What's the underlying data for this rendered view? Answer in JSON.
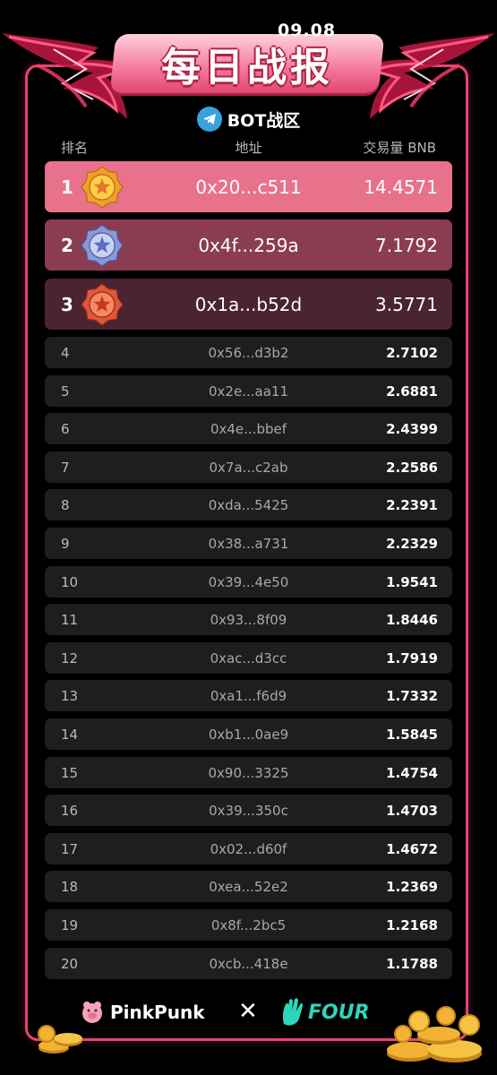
{
  "header": {
    "date": "09.08",
    "title": "每日战报",
    "zone_label": "BOT战区"
  },
  "columns": {
    "rank": "排名",
    "address": "地址",
    "volume": "交易量 BNB"
  },
  "top3": [
    {
      "rank": "1",
      "address": "0x20...c511",
      "volume": "14.4571",
      "medal": "gold-medal-icon",
      "bg": "#e8728c"
    },
    {
      "rank": "2",
      "address": "0x4f...259a",
      "volume": "7.1792",
      "medal": "silver-medal-icon",
      "bg": "#8a3d52"
    },
    {
      "rank": "3",
      "address": "0x1a...b52d",
      "volume": "3.5771",
      "medal": "bronze-medal-icon",
      "bg": "#4a2430"
    }
  ],
  "rows": [
    {
      "rank": "4",
      "address": "0x56...d3b2",
      "volume": "2.7102"
    },
    {
      "rank": "5",
      "address": "0x2e...aa11",
      "volume": "2.6881"
    },
    {
      "rank": "6",
      "address": "0x4e...bbef",
      "volume": "2.4399"
    },
    {
      "rank": "7",
      "address": "0x7a...c2ab",
      "volume": "2.2586"
    },
    {
      "rank": "8",
      "address": "0xda...5425",
      "volume": "2.2391"
    },
    {
      "rank": "9",
      "address": "0x38...a731",
      "volume": "2.2329"
    },
    {
      "rank": "10",
      "address": "0x39...4e50",
      "volume": "1.9541"
    },
    {
      "rank": "11",
      "address": "0x93...8f09",
      "volume": "1.8446"
    },
    {
      "rank": "12",
      "address": "0xac...d3cc",
      "volume": "1.7919"
    },
    {
      "rank": "13",
      "address": "0xa1...f6d9",
      "volume": "1.7332"
    },
    {
      "rank": "14",
      "address": "0xb1...0ae9",
      "volume": "1.5845"
    },
    {
      "rank": "15",
      "address": "0x90...3325",
      "volume": "1.4754"
    },
    {
      "rank": "16",
      "address": "0x39...350c",
      "volume": "1.4703"
    },
    {
      "rank": "17",
      "address": "0x02...d60f",
      "volume": "1.4672"
    },
    {
      "rank": "18",
      "address": "0xea...52e2",
      "volume": "1.2369"
    },
    {
      "rank": "19",
      "address": "0x8f...2bc5",
      "volume": "1.2168"
    },
    {
      "rank": "20",
      "address": "0xcb...418e",
      "volume": "1.1788"
    }
  ],
  "footer": {
    "brand_left": "PinkPunk",
    "collab_symbol": "✕",
    "brand_right": "FOUR"
  },
  "colors": {
    "accent": "#e8436e",
    "row_bg": "#1e1e1e",
    "four_brand": "#2ed6b9"
  }
}
